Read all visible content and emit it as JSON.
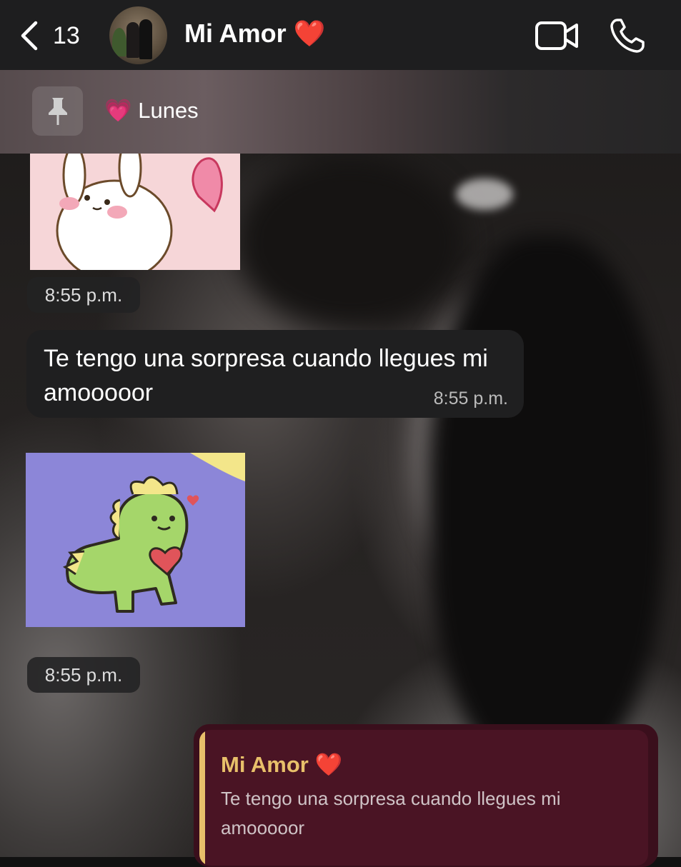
{
  "header": {
    "back_count": "13",
    "contact_name": "Mi Amor ❤️"
  },
  "pinned": {
    "text": "💗 Lunes"
  },
  "messages": {
    "time_1": "8:55 p.m.",
    "incoming_text": "Te tengo una sorpresa cuando llegues mi amooooor",
    "incoming_time": "8:55 p.m.",
    "time_2": "8:55 p.m."
  },
  "reply": {
    "quoted_name": "Mi Amor ❤️",
    "quoted_text": "Te tengo una sorpresa cuando llegues mi amooooor"
  },
  "colors": {
    "header_bg": "#1e1e1f",
    "incoming_bubble": "#1f1f20",
    "outgoing_bubble": "#3a0f1c",
    "quote_accent": "#e8c06a"
  },
  "icons": [
    "chevron-left-icon",
    "video-camera-icon",
    "phone-icon",
    "pin-icon"
  ]
}
